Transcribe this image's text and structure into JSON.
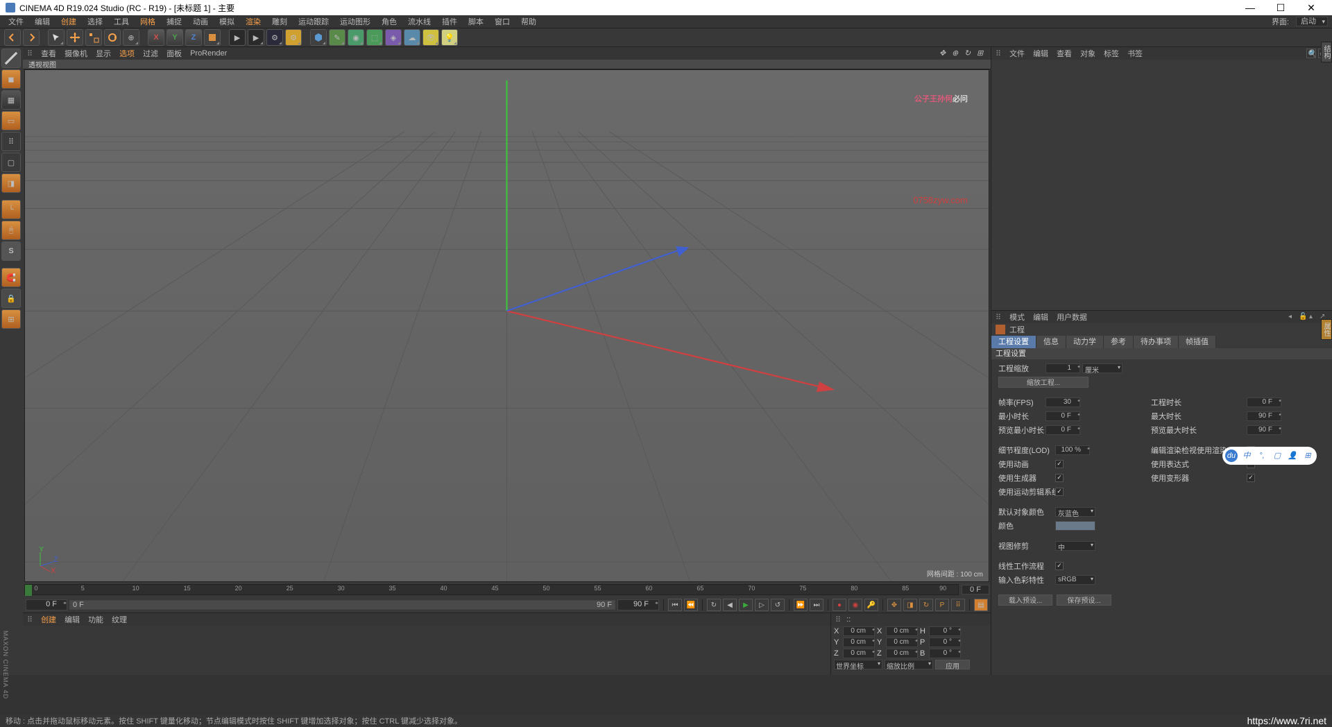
{
  "title": "CINEMA 4D R19.024 Studio (RC - R19) - [未标题 1] - 主要",
  "menubar": {
    "items": [
      "文件",
      "编辑",
      "创建",
      "选择",
      "工具",
      "网格",
      "捕捉",
      "动画",
      "模拟",
      "渲染",
      "雕刻",
      "运动跟踪",
      "运动图形",
      "角色",
      "流水线",
      "插件",
      "脚本",
      "窗口",
      "帮助"
    ],
    "hl": [
      2,
      5,
      9
    ],
    "layout_lbl": "界面:",
    "layout_val": "启动"
  },
  "viewmenu": {
    "items": [
      "查看",
      "摄像机",
      "显示",
      "选项",
      "过滤",
      "面板",
      "ProRender"
    ],
    "hl": [
      3
    ],
    "tab": "透视视图",
    "gridinfo": "网格间距 : 100 cm"
  },
  "watermark1a": "公子王孙何",
  "watermark1b": "必问",
  "watermark2": "0758zyw.com",
  "timeline": {
    "ticks": [
      "0",
      "5",
      "10",
      "15",
      "20",
      "25",
      "30",
      "35",
      "40",
      "45",
      "50",
      "55",
      "60",
      "65",
      "70",
      "75",
      "80",
      "85",
      "90"
    ],
    "end": "0 F"
  },
  "tcontrols": {
    "start": "0 F",
    "cur": "0 F",
    "end": "90 F",
    "end2": "90 F"
  },
  "matpanel": {
    "items": [
      "创建",
      "编辑",
      "功能",
      "纹理"
    ],
    "hl": [
      0
    ]
  },
  "coord": {
    "hdr": "::",
    "x": "0 cm",
    "y": "0 cm",
    "z": "0 cm",
    "sx": "0 cm",
    "sy": "0 cm",
    "sz": "0 cm",
    "h": "0 °",
    "p": "0 °",
    "b": "0 °",
    "modeA": "世界坐标",
    "modeB": "缩放比例",
    "apply": "应用"
  },
  "objmenu": {
    "items": [
      "文件",
      "编辑",
      "查看",
      "对象",
      "标签",
      "书签"
    ],
    "hl": [
      3
    ]
  },
  "attrmenu": {
    "items": [
      "模式",
      "编辑",
      "用户数据"
    ]
  },
  "attr": {
    "title": "工程",
    "tabs": [
      "工程设置",
      "信息",
      "动力学",
      "参考",
      "待办事项",
      "帧插值"
    ],
    "sect": "工程设置",
    "scale_lbl": "工程缩放",
    "scale_val": "1",
    "scale_unit": "厘米",
    "scale_btn": "缩放工程...",
    "fps_lbl": "帧率(FPS)",
    "fps_val": "30",
    "dur_lbl": "工程时长",
    "dur_val": "0 F",
    "min_lbl": "最小时长",
    "min_val": "0 F",
    "max_lbl": "最大时长",
    "max_val": "90 F",
    "pmin_lbl": "预览最小时长",
    "pmin_val": "0 F",
    "pmax_lbl": "预览最大时长",
    "pmax_val": "90 F",
    "lod_lbl": "细节程度(LOD)",
    "lod_val": "100 %",
    "lodedit_lbl": "编辑渲染检视使用渲染LOD级别",
    "anim_lbl": "使用动画",
    "expr_lbl": "使用表达式",
    "gen_lbl": "使用生成器",
    "def_lbl": "使用变形器",
    "mclip_lbl": "使用运动剪辑系统",
    "defc_lbl": "默认对象颜色",
    "defc_val": "灰蓝色",
    "color_lbl": "颜色",
    "clip_lbl": "视图修剪",
    "clip_val": "中",
    "linear_lbl": "线性工作流程",
    "colspace_lbl": "输入色彩特性",
    "colspace_val": "sRGB",
    "load_btn": "载入预设...",
    "save_btn": "保存预设..."
  },
  "status": "移动 : 点击并拖动鼠标移动元素。按住 SHIFT 键量化移动；节点编辑模式时按住 SHIFT 键增加选择对象；按住 CTRL 键减少选择对象。",
  "url": "https://www.7ri.net",
  "vtext": "MAXON CINEMA 4D"
}
